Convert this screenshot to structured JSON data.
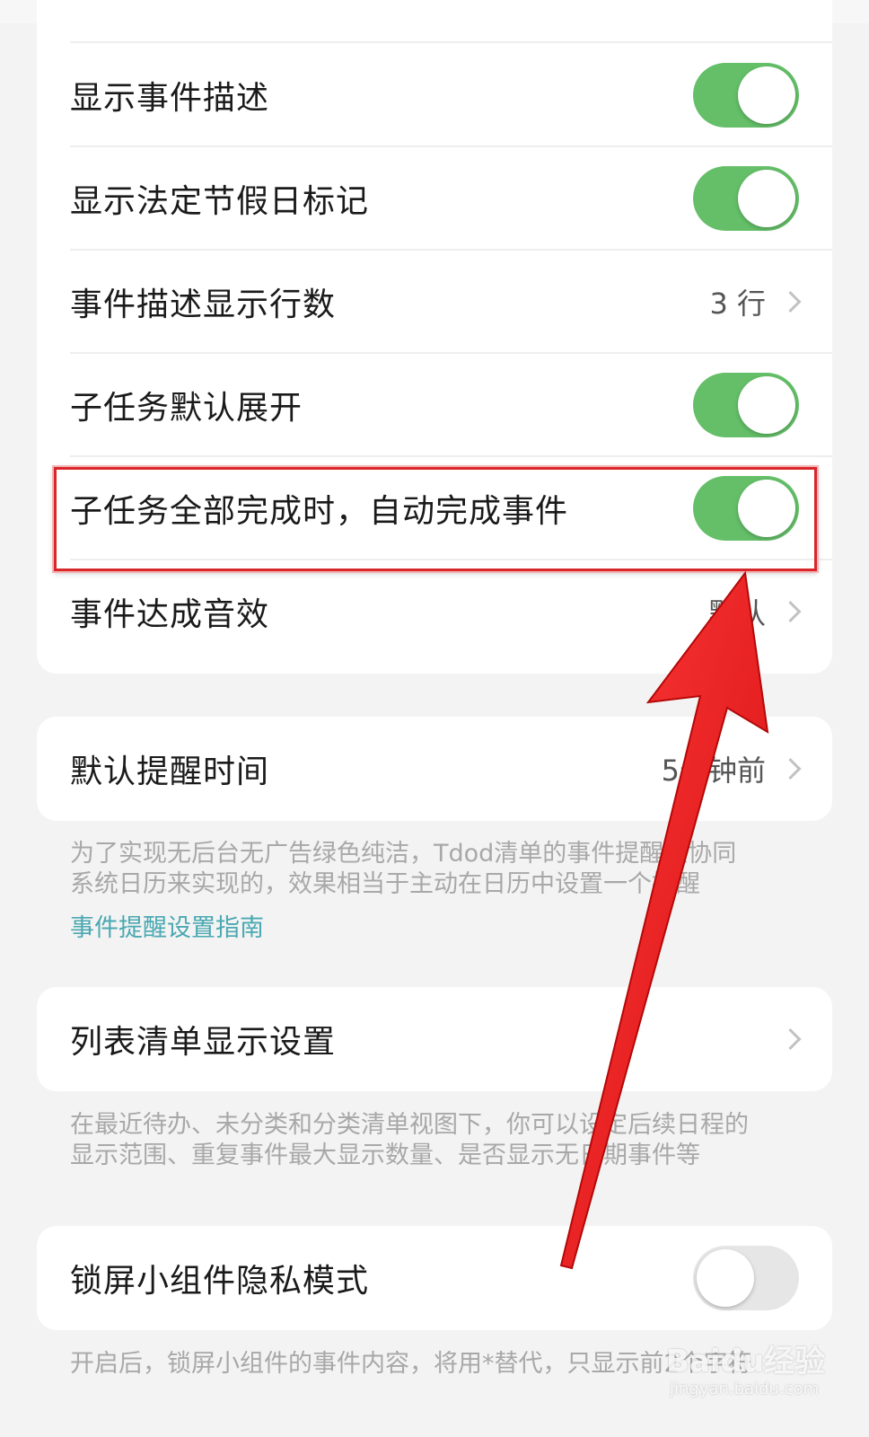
{
  "settings_top": {
    "rows": [
      {
        "label": "显示事件描述",
        "toggle_on": true
      },
      {
        "label": "显示法定节假日标记",
        "toggle_on": true
      },
      {
        "label": "事件描述显示行数",
        "value": "3 行"
      },
      {
        "label": "子任务默认展开",
        "toggle_on": true
      },
      {
        "label": "子任务全部完成时，自动完成事件",
        "toggle_on": true
      },
      {
        "label": "事件达成音效",
        "value": "默认"
      }
    ]
  },
  "reminder": {
    "label": "默认提醒时间",
    "value": "5分钟前",
    "note_line1": "为了实现无后台无广告绿色纯洁，Tdod清单的事件提醒是协同",
    "note_line2": "系统日历来实现的，效果相当于主动在日历中设置一个提醒",
    "link": "事件提醒设置指南"
  },
  "list_display": {
    "label": "列表清单显示设置",
    "note_line1": "在最近待办、未分类和分类清单视图下，你可以设定后续日程的",
    "note_line2": "显示范围、重复事件最大显示数量、是否显示无日期事件等"
  },
  "lock_widget": {
    "label": "锁屏小组件隐私模式",
    "toggle_on": false,
    "note": "开启后，锁屏小组件的事件内容，将用*替代，只显示前2个字符"
  },
  "watermark": {
    "brand": "Baidu经验",
    "url": "jingyan.baidu.com"
  },
  "colors": {
    "toggle_on": "#64bf68",
    "toggle_off": "#e6e6e6",
    "link": "#4aa8b2",
    "highlight": "#d8262a",
    "arrow": "#ee1c1c"
  }
}
